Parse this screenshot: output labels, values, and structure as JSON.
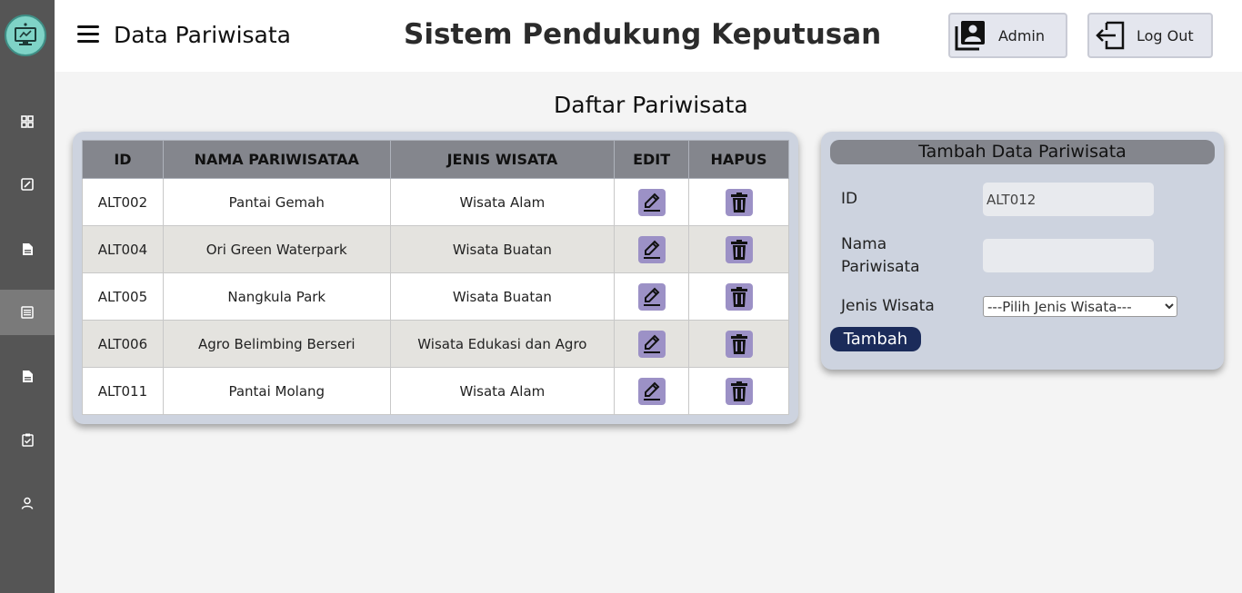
{
  "header": {
    "page_title": "Data Pariwisata",
    "app_title": "Sistem Pendukung Keputusan",
    "admin_label": "Admin",
    "logout_label": "Log Out"
  },
  "sidebar": {
    "items": [
      {
        "icon": "dashboard-icon"
      },
      {
        "icon": "edit-box-icon"
      },
      {
        "icon": "document-icon"
      },
      {
        "icon": "list-icon",
        "active": true
      },
      {
        "icon": "document-icon"
      },
      {
        "icon": "clipboard-check-icon"
      },
      {
        "icon": "user-icon"
      }
    ]
  },
  "section_title": "Daftar Pariwisata",
  "table": {
    "headers": [
      "ID",
      "NAMA PARIWISATAA",
      "JENIS WISATA",
      "EDIT",
      "HAPUS"
    ],
    "rows": [
      {
        "id": "ALT002",
        "nama": "Pantai Gemah",
        "jenis": "Wisata Alam"
      },
      {
        "id": "ALT004",
        "nama": "Ori Green Waterpark",
        "jenis": "Wisata Buatan"
      },
      {
        "id": "ALT005",
        "nama": "Nangkula Park",
        "jenis": "Wisata Buatan"
      },
      {
        "id": "ALT006",
        "nama": "Agro Belimbing Berseri",
        "jenis": "Wisata Edukasi dan Agro"
      },
      {
        "id": "ALT011",
        "nama": "Pantai Molang",
        "jenis": "Wisata Alam"
      }
    ]
  },
  "form": {
    "title": "Tambah Data Pariwisata",
    "id_label": "ID",
    "id_value": "ALT012",
    "nama_label_1": "Nama",
    "nama_label_2": "Pariwisata",
    "nama_value": "",
    "jenis_label": "Jenis Wisata",
    "jenis_selected": "---Pilih Jenis Wisata---",
    "submit_label": "Tambah"
  },
  "colors": {
    "sidebar": "#555555",
    "table_header": "#84868d",
    "icon_button": "#9c91c6",
    "submit_button": "#1b2b5a",
    "card": "#cdd3df"
  }
}
